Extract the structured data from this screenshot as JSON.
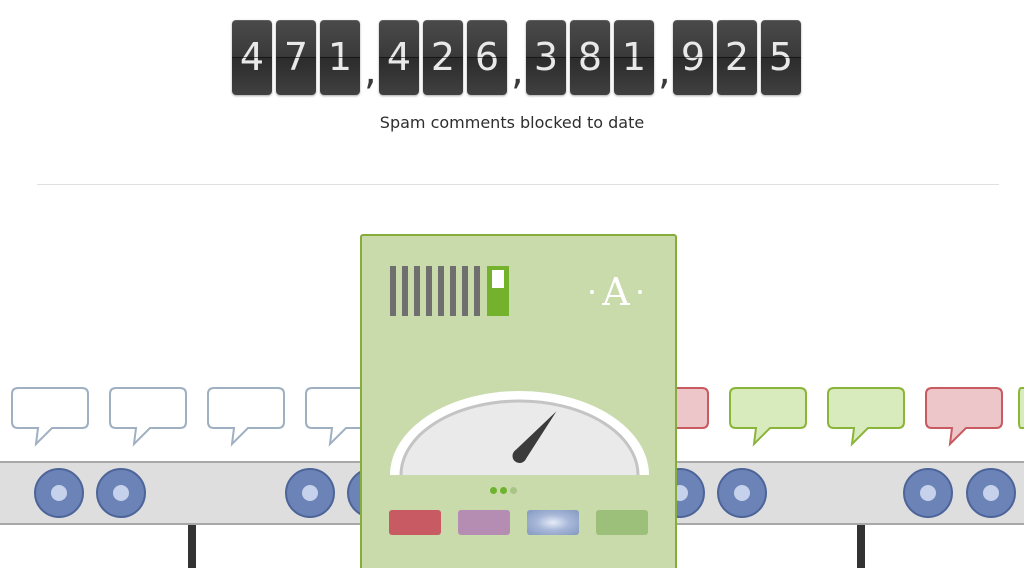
{
  "counter": {
    "digits": [
      "4",
      "7",
      "1",
      "4",
      "2",
      "6",
      "3",
      "8",
      "1",
      "9",
      "2",
      "5"
    ],
    "separator": ",",
    "caption": "Spam comments blocked to date"
  },
  "logo": {
    "letter": "A"
  },
  "colors": {
    "ham_bubble": "#8bb53a",
    "ham_fill": "#d8ebbd",
    "spam_bubble": "#c95a5f",
    "spam_fill": "#ecc6c8",
    "pending_bubble": "#9fb0c2",
    "machine_fill": "#c9dbaa",
    "machine_border": "#86ad3c",
    "wheel": "#6b83b6",
    "led_red": "#c85a63",
    "led_purple": "#b58db3",
    "led_blue": "#8ea2c6",
    "led_green": "#9cc07a",
    "switch": "#74b12c"
  },
  "gauge": {
    "needle_level": 0.72
  },
  "icons": {
    "incoming": "speech-bubble-icon",
    "spam": "speech-bubble-icon",
    "approved": "speech-bubble-icon",
    "logo": "akismet-logo-icon"
  }
}
